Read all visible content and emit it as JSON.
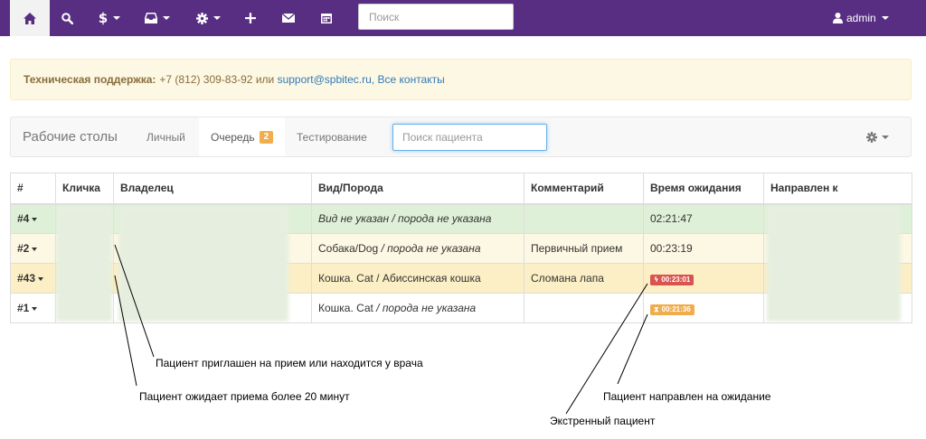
{
  "navbar": {
    "search_placeholder": "Поиск",
    "user": "admin",
    "icons": [
      "home-icon",
      "search-icon",
      "dollar-icon",
      "inbox-icon",
      "gear-icon",
      "plus-icon",
      "envelope-icon",
      "calendar-icon"
    ],
    "brand_color": "#582e82"
  },
  "alert": {
    "label": "Техническая поддержка:",
    "phone": "+7 (812) 309-83-92 или",
    "email": "support@spbitec.ru,",
    "contacts_link": "Все контакты"
  },
  "subnav": {
    "brand": "Рабочие столы",
    "tabs": [
      {
        "label": "Личный"
      },
      {
        "label": "Очередь",
        "badge": "2"
      },
      {
        "label": "Тестирование"
      }
    ],
    "search_placeholder": "Поиск пациента"
  },
  "table": {
    "headers": [
      "#",
      "Кличка",
      "Владелец",
      "Вид/Порода",
      "Комментарий",
      "Время ожидания",
      "Направлен к"
    ],
    "rows": [
      {
        "num": "#4",
        "species": "",
        "species_note": "Вид не указан / порода не указана",
        "comment": "",
        "wait": "02:21:47",
        "status": "success"
      },
      {
        "num": "#2",
        "species": "Собака/Dog",
        "species_note": " / порода не указана",
        "comment": "Первичный прием",
        "wait": "00:23:19",
        "status": "warning"
      },
      {
        "num": "#43",
        "species": "Кошка. Cat / Абиссинская кошка",
        "species_note": "",
        "comment": "Сломана лапа",
        "wait_badge": "00:23:01",
        "wait_badge_color": "#d9534f",
        "status": "danger"
      },
      {
        "num": "#1",
        "species": "Кошка. Cat",
        "species_note": " / порода не указана",
        "comment": "",
        "wait_badge": "00:21:36",
        "wait_badge_color": "#f0ad4e",
        "status": "plain"
      }
    ]
  },
  "annotations": {
    "invited": "Пациент приглашен на прием или находится у врача",
    "waiting": "Пациент ожидает приема более 20 минут",
    "directed": "Пациент направлен на ожидание",
    "emergency": "Экстренный пациент"
  }
}
